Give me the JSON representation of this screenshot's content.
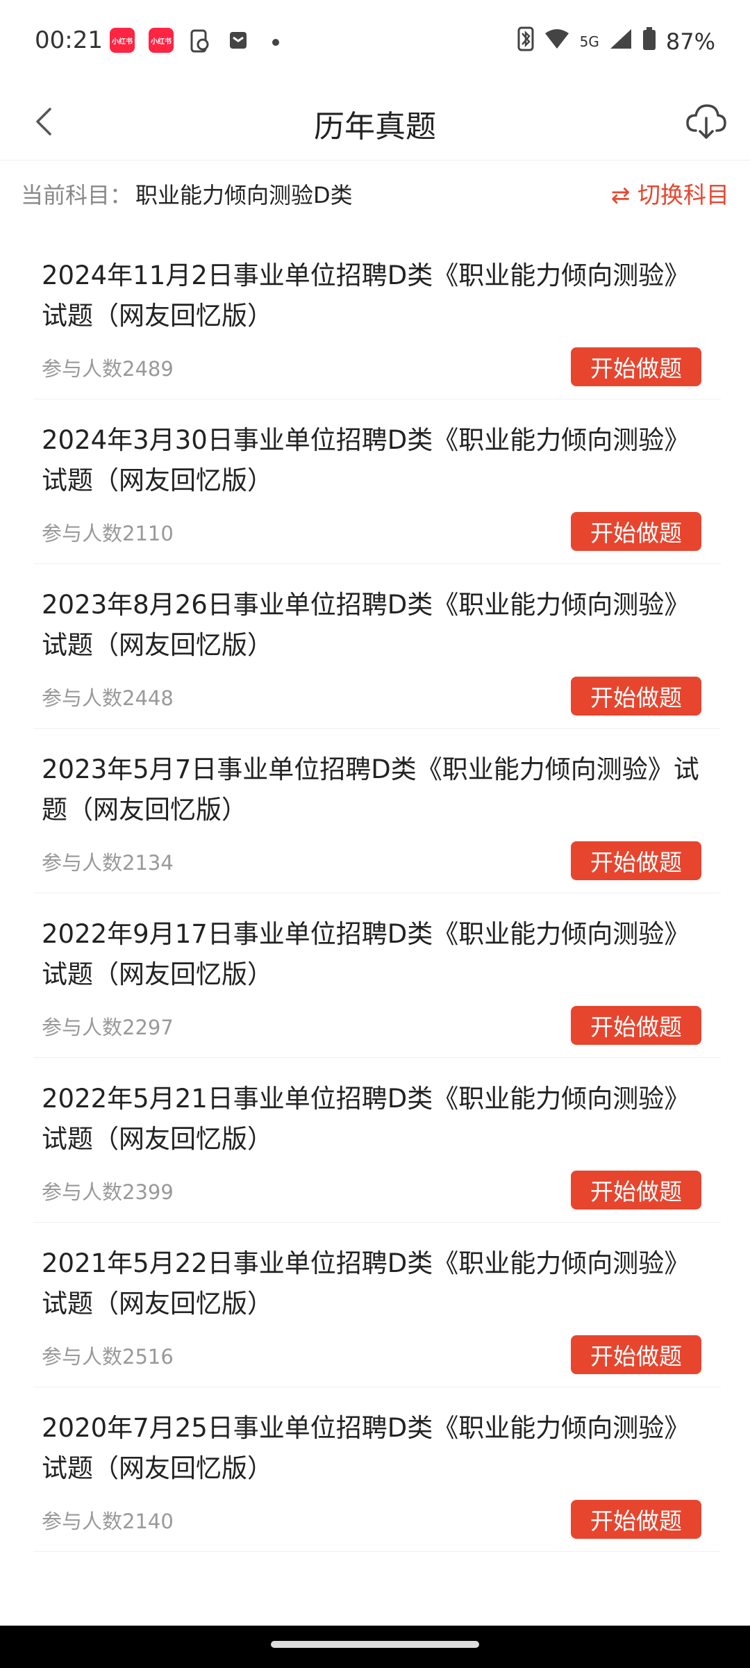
{
  "status_bar": {
    "time": "00:21",
    "app_icon_label": "小红书",
    "network": "5G",
    "battery": "87%"
  },
  "header": {
    "title": "历年真题",
    "back_icon": "chevron-left-icon",
    "download_icon": "cloud-download-icon"
  },
  "subject": {
    "label": "当前科目：",
    "value": "职业能力倾向测验D类",
    "switch_label": "⇄ 切换科目"
  },
  "colors": {
    "accent": "#e8452e"
  },
  "items": [
    {
      "title": "2024年11月2日事业单位招聘D类《职业能力倾向测验》试题（网友回忆版）",
      "count": "参与人数2489",
      "button": "开始做题"
    },
    {
      "title": "2024年3月30日事业单位招聘D类《职业能力倾向测验》试题（网友回忆版）",
      "count": "参与人数2110",
      "button": "开始做题"
    },
    {
      "title": "2023年8月26日事业单位招聘D类《职业能力倾向测验》试题（网友回忆版）",
      "count": "参与人数2448",
      "button": "开始做题"
    },
    {
      "title": "2023年5月7日事业单位招聘D类《职业能力倾向测验》试题（网友回忆版）",
      "count": "参与人数2134",
      "button": "开始做题"
    },
    {
      "title": "2022年9月17日事业单位招聘D类《职业能力倾向测验》试题（网友回忆版）",
      "count": "参与人数2297",
      "button": "开始做题"
    },
    {
      "title": "2022年5月21日事业单位招聘D类《职业能力倾向测验》试题（网友回忆版）",
      "count": "参与人数2399",
      "button": "开始做题"
    },
    {
      "title": "2021年5月22日事业单位招聘D类《职业能力倾向测验》试题（网友回忆版）",
      "count": "参与人数2516",
      "button": "开始做题"
    },
    {
      "title": "2020年7月25日事业单位招聘D类《职业能力倾向测验》试题（网友回忆版）",
      "count": "参与人数2140",
      "button": "开始做题"
    }
  ]
}
